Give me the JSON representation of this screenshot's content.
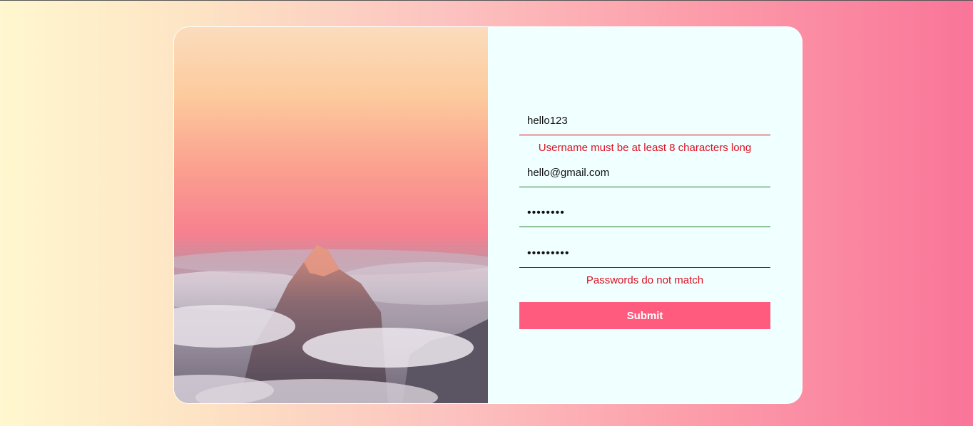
{
  "form": {
    "username": {
      "value": "hello123",
      "error": "Username must be at least 8 characters long"
    },
    "email": {
      "value": "hello@gmail.com"
    },
    "password": {
      "value": "12345678"
    },
    "confirm_password": {
      "value": "123456789",
      "error": "Passwords do not match"
    },
    "submit_label": "Submit"
  },
  "colors": {
    "error": "#dd1122",
    "valid_underline": "#1a7a1a",
    "invalid_underline": "#cc0000",
    "submit_bg": "#ff5b7e",
    "form_bg": "#f0ffff"
  }
}
